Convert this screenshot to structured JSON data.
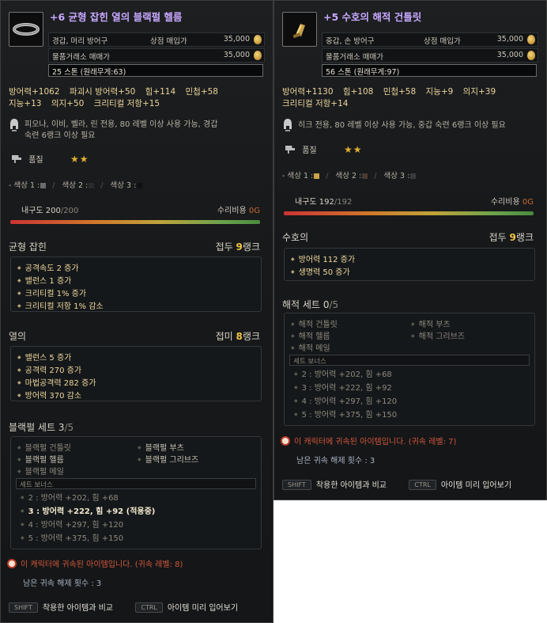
{
  "tooltip_a": {
    "title": "+6 균형 잡힌 열의 블랙펄 헬름",
    "icon": "helm-ring-icon",
    "category": "경갑, 머리 방어구",
    "shop_label": "상점 매입가",
    "shop_price": "35,000",
    "market_label": "물품거래소 매매가",
    "market_price": "35,000",
    "weight": "25 스톤 (원래무게:63)",
    "stats_line1": [
      "방어력+1062",
      "파괴시 방어력+50",
      "힘+114",
      "민첩+58"
    ],
    "stats_line2": [
      "지능+13",
      "의지+50",
      "크리티컬 저항+15"
    ],
    "requirement_1": "피오나, 이비, 벨라, 린 전용, 80 레벨 이상 사용 가능, 경갑",
    "requirement_2": "숙련 6랭크 이상 필요",
    "grade_label": "품질",
    "grade_stars": "★★",
    "dyes": [
      "- 색상 1 :",
      "색상 2 :",
      "색상 3 :"
    ],
    "dye_colors": [
      "#6b6b6b",
      "#2a2a2a",
      "#111111"
    ],
    "durability_label": "내구도",
    "durability_current": "200",
    "durability_max": "/200",
    "durability_fraction": 1.0,
    "repair_label": "수리비용",
    "repair_cost": "0G",
    "prefix1": {
      "name": "균형 잡힌",
      "rank_prefix": "접두",
      "rank_value": "9",
      "rank_suffix": "랭크",
      "effects": [
        "공격속도 2 증가",
        "밸런스 1 증가",
        "크리티컬 1% 증가",
        "크리티컬 저항 1% 감소"
      ]
    },
    "prefix2": {
      "name": "열의",
      "rank_prefix": "접미",
      "rank_value": "8",
      "rank_suffix": "랭크",
      "effects": [
        "밸런스 5 증가",
        "공격력 270 증가",
        "마법공격력 282 증가",
        "방어력 370 감소"
      ]
    },
    "set": {
      "name": "블랙펄 세트",
      "count": "3",
      "total": "/5",
      "items": [
        "블랙펄 건틀릿",
        "블랙펄 부츠",
        "블랙펄 헬름",
        "블랙펄 그리브즈",
        "블랙펄 메일"
      ],
      "bonus_header": "세트 보너스",
      "bonuses": [
        "2 : 방어력 +202, 힘 +68",
        "3 : 방어력 +222, 힘 +92 (적용중)",
        "4 : 방어력 +297, 힘 +120",
        "5 : 방어력 +375, 힘 +150"
      ]
    },
    "bind_text": "이 캐릭터에 귀속된 아이템입니다. (귀속 레벨: 8)",
    "unbind_text": "남은 귀속 해제 횟수 : 3",
    "key1": "SHIFT",
    "key1_label": "착용한 아이템과 비교",
    "key2": "CTRL",
    "key2_label": "아이템 미리 입어보기"
  },
  "tooltip_b": {
    "title": "+5 수호의 해적 건틀릿",
    "icon": "gauntlet-icon",
    "category": "중갑, 손 방어구",
    "shop_label": "상점 매입가",
    "shop_price": "35,000",
    "market_label": "물품거래소 매매가",
    "market_price": "35,000",
    "weight": "56 스톤 (원래무게:97)",
    "stats_line1": [
      "방어력+1130",
      "힘+108",
      "민첩+58",
      "지능+9",
      "의지+39"
    ],
    "stats_line2": [
      "크리티컬 저항+14"
    ],
    "requirement_1": "히크 전용, 80 레벨 이상 사용 가능, 중갑 숙련 6랭크 이상 필요",
    "grade_label": "품질",
    "grade_stars": "★★",
    "dyes": [
      "- 색상 1 :",
      "색상 2 :",
      "색상 3 :"
    ],
    "dye_colors": [
      "#c9a24a",
      "#4a3a32",
      "#3a3a3a"
    ],
    "durability_label": "내구도",
    "durability_current": "192",
    "durability_max": "/192",
    "durability_fraction": 1.0,
    "repair_label": "수리비용",
    "repair_cost": "0G",
    "prefix1": {
      "name": "수호의",
      "rank_prefix": "접두",
      "rank_value": "9",
      "rank_suffix": "랭크",
      "effects": [
        "방어력 112 증가",
        "생명력 50 증가"
      ]
    },
    "set": {
      "name": "해적 세트",
      "count": "0",
      "total": "/5",
      "items": [
        "해적 건틀릿",
        "해적 부츠",
        "해적 헬름",
        "해적 그리브즈",
        "해적 메일"
      ],
      "bonus_header": "세트 보너스",
      "bonuses": [
        "2 : 방어력 +202, 힘 +68",
        "3 : 방어력 +222, 힘 +92",
        "4 : 방어력 +297, 힘 +120",
        "5 : 방어력 +375, 힘 +150"
      ]
    },
    "bind_text": "이 캐릭터에 귀속된 아이템입니다. (귀속 레벨: 7)",
    "unbind_text": "남은 귀속 해제 횟수 : 3",
    "key1": "SHIFT",
    "key1_label": "착용한 아이템과 비교",
    "key2": "CTRL",
    "key2_label": "아이템 미리 입어보기"
  }
}
